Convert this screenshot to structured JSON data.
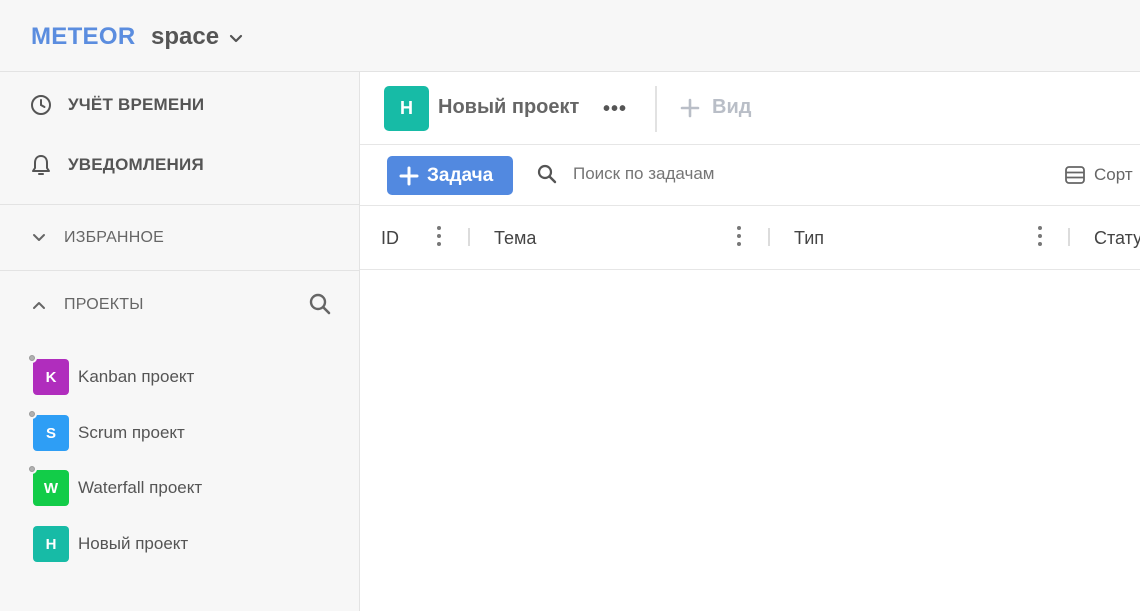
{
  "header": {
    "brand": "METEOR",
    "workspace": "space"
  },
  "sidebar": {
    "nav": [
      {
        "label": "УЧЁТ ВРЕМЕНИ",
        "icon": "clock-icon"
      },
      {
        "label": "УВЕДОМЛЕНИЯ",
        "icon": "bell-icon"
      }
    ],
    "favorites_label": "ИЗБРАННОЕ",
    "projects_label": "ПРОЕКТЫ",
    "projects": [
      {
        "letter": "K",
        "name": "Kanban проект",
        "color": "#b02dbd"
      },
      {
        "letter": "S",
        "name": "Scrum проект",
        "color": "#2e9ef5"
      },
      {
        "letter": "W",
        "name": "Waterfall проект",
        "color": "#12cc48"
      },
      {
        "letter": "Н",
        "name": "Новый проект",
        "color": "#17bba6"
      }
    ]
  },
  "project": {
    "letter": "Н",
    "title": "Новый проект",
    "more": "•••",
    "add_view": "Вид"
  },
  "toolbar": {
    "add_task": "Задача",
    "search_placeholder": "Поиск по задачам",
    "sort": "Сорт"
  },
  "table": {
    "columns": [
      "ID",
      "Тема",
      "Тип",
      "Стату"
    ]
  },
  "colors": {
    "brand": "#5b8ddf",
    "primary_button": "#5289e0",
    "sidebar_bg": "#f7f7f7"
  }
}
